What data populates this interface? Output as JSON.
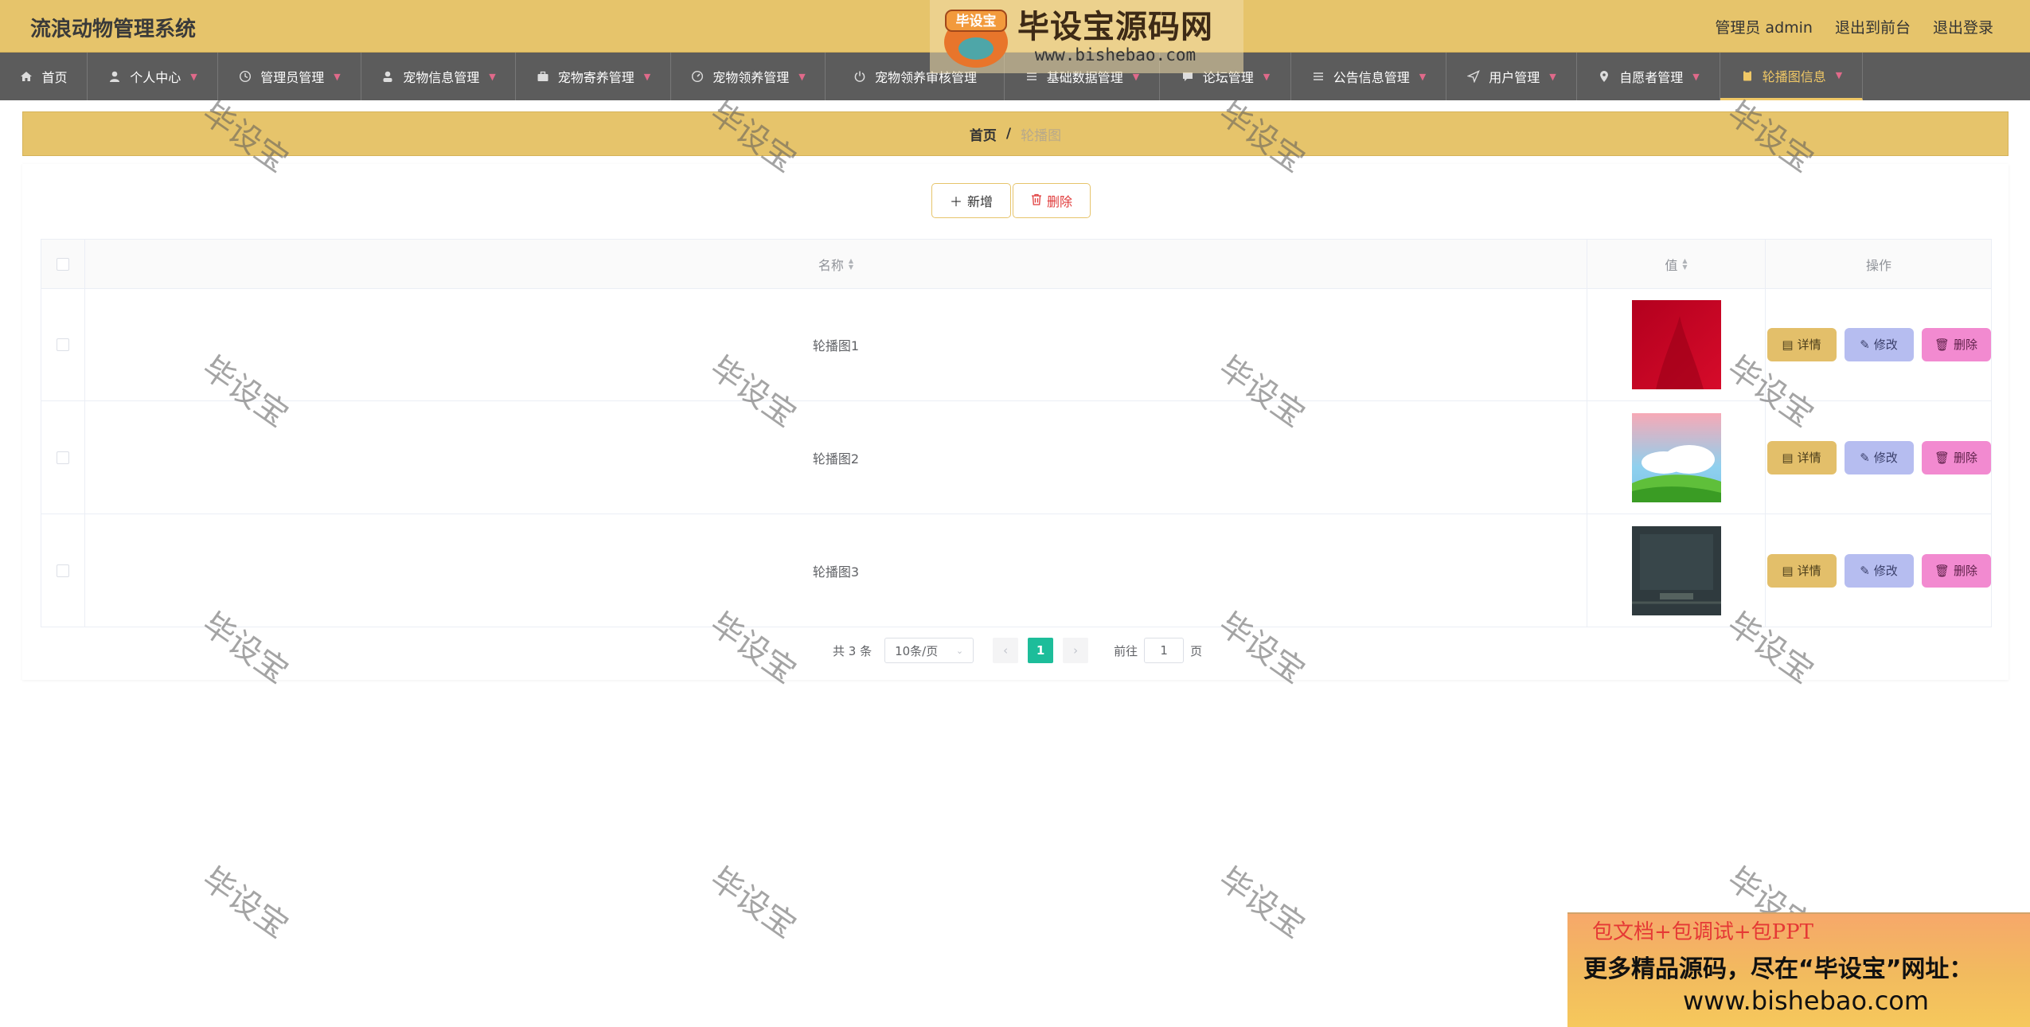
{
  "header": {
    "title": "流浪动物管理系统",
    "user_label": "管理员 admin",
    "front_label": "退出到前台",
    "logout_label": "退出登录"
  },
  "nav": [
    {
      "label": "首页",
      "icon": "home-icon"
    },
    {
      "label": "个人中心",
      "icon": "user-icon"
    },
    {
      "label": "管理员管理",
      "icon": "clock-icon"
    },
    {
      "label": "宠物信息管理",
      "icon": "person-icon"
    },
    {
      "label": "宠物寄养管理",
      "icon": "briefcase-icon"
    },
    {
      "label": "宠物领养管理",
      "icon": "dashboard-icon"
    },
    {
      "label": "宠物领养审核管理",
      "icon": "power-icon"
    },
    {
      "label": "基础数据管理",
      "icon": "list-icon"
    },
    {
      "label": "论坛管理",
      "icon": "chat-icon"
    },
    {
      "label": "公告信息管理",
      "icon": "list-icon"
    },
    {
      "label": "用户管理",
      "icon": "send-icon"
    },
    {
      "label": "自愿者管理",
      "icon": "location-icon"
    },
    {
      "label": "轮播图信息",
      "icon": "clipboard-icon"
    }
  ],
  "breadcrumb": {
    "home": "首页",
    "separator": "/",
    "current": "轮播图"
  },
  "toolbar": {
    "add_label": "新增",
    "delete_label": "删除"
  },
  "table": {
    "columns": {
      "name": "名称",
      "value": "值",
      "actions": "操作"
    },
    "rows": [
      {
        "name": "轮播图1",
        "image": "red-banner"
      },
      {
        "name": "轮播图2",
        "image": "sky-meadow-banner"
      },
      {
        "name": "轮播图3",
        "image": "dark-banner"
      }
    ],
    "row_actions": {
      "detail": "详情",
      "edit": "修改",
      "delete": "删除"
    }
  },
  "pagination": {
    "total_text": "共 3 条",
    "page_size": "10条/页",
    "current_page": "1",
    "goto_prefix": "前往",
    "goto_value": "1",
    "goto_suffix": "页"
  },
  "watermark": {
    "text": "毕设宝"
  },
  "logo": {
    "badge": "毕设宝",
    "name": "毕设宝源码网",
    "url": "www.bishebao.com"
  },
  "ad": {
    "line1": "包文档+包调试+包PPT",
    "line2": "更多精品源码，尽在“毕设宝”网址：",
    "line3": "www.bishebao.com"
  },
  "colors": {
    "header_bg": "#e6c46b",
    "nav_bg": "#5c5c5c",
    "nav_active": "#f0c866",
    "pager_active": "#1dbd9a",
    "btn_detail": "#e3bf6a",
    "btn_edit": "#b6bdf0",
    "btn_delete": "#f28ad0"
  }
}
